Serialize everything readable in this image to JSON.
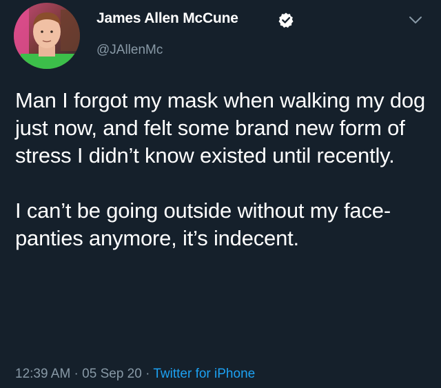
{
  "user": {
    "display_name": "James Allen McCune",
    "handle": "@JAllenMc",
    "verified": true
  },
  "tweet": {
    "paragraphs": [
      "Man I forgot my mask when walking my dog just now, and felt some brand new form of stress I didn’t know existed until recently.",
      "I can’t be going outside without my face-panties anymore, it’s indecent."
    ],
    "time": "12:39 AM",
    "date": "05 Sep 20",
    "source": "Twitter for iPhone",
    "separator": " · "
  },
  "colors": {
    "background": "#15202b",
    "text": "#ffffff",
    "secondary": "#8899a6",
    "link": "#1da1f2"
  },
  "icons": {
    "verified": "verified-badge-icon",
    "menu": "chevron-down-icon"
  }
}
